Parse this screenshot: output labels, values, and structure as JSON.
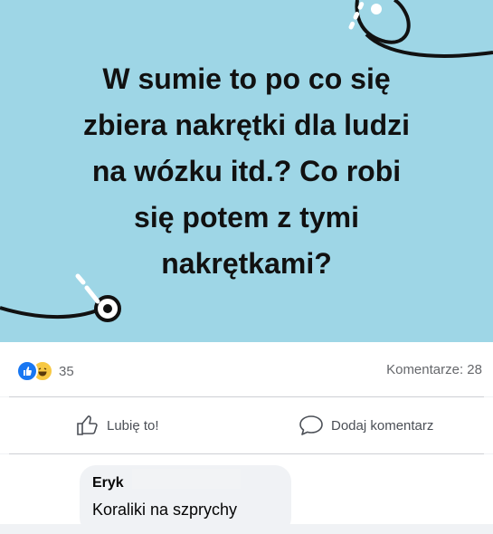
{
  "post": {
    "text_lines": [
      "W sumie to po co się",
      "zbiera nakrętki dla ludzi",
      "na wózku itd.? Co robi",
      "się potem z tymi",
      "nakrętkami?"
    ],
    "background_color": "#9ed6e6"
  },
  "stats": {
    "reaction_count": "35",
    "comments_label": "Komentarze: 28",
    "reaction_icons": [
      "like-icon",
      "haha-icon"
    ]
  },
  "actions": {
    "like_label": "Lubię to!",
    "comment_label": "Dodaj komentarz"
  },
  "comment": {
    "author": "Eryk",
    "text": "Koraliki na szprychy"
  }
}
